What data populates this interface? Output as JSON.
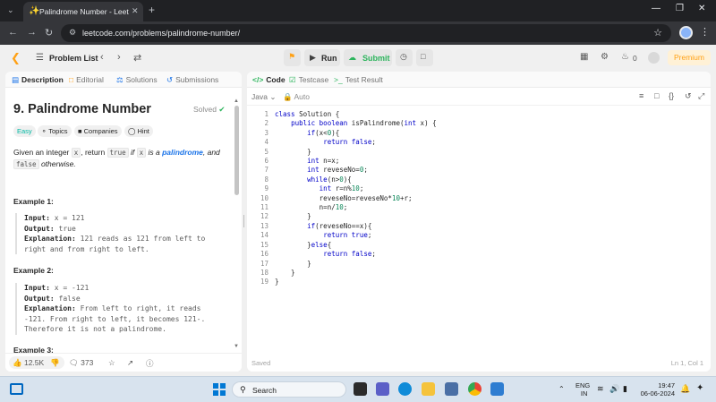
{
  "browser": {
    "tab_title": "Palindrome Number - LeetCode",
    "url": "leetcode.com/problems/palindrome-number/"
  },
  "navbar": {
    "problem_list": "Problem List",
    "run": "Run",
    "submit": "Submit",
    "streak_count": "0",
    "premium": "Premium"
  },
  "left_tabs": [
    "Description",
    "Editorial",
    "Solutions",
    "Submissions"
  ],
  "problem": {
    "title": "9. Palindrome Number",
    "status": "Solved",
    "tags": [
      "Easy",
      "Topics",
      "Companies",
      "Hint"
    ],
    "desc": {
      "p1": "Given an integer ",
      "x": "x",
      "p2": ", return ",
      "true": "true",
      "p3": " if ",
      "p4": " is a ",
      "palindrome": "palindrome",
      "p5": ", and",
      "false": "false",
      "p6": " otherwise."
    },
    "examples": [
      {
        "title": "Example 1:",
        "input_label": "Input:",
        "input": "x = 121",
        "output_label": "Output:",
        "output": "true",
        "explanation_label": "Explanation:",
        "explanation_1": "121 reads as 121 from left to",
        "explanation_2": "right and from right to left.",
        "explanation_3": ""
      },
      {
        "title": "Example 2:",
        "input_label": "Input:",
        "input": "x = -121",
        "output_label": "Output:",
        "output": "false",
        "explanation_label": "Explanation:",
        "explanation_1": "From left to right, it reads",
        "explanation_2": "-121. From right to left, it becomes 121-.",
        "explanation_3": "Therefore it is not a palindrome."
      }
    ],
    "example3_title": "Example 3:"
  },
  "left_footer": {
    "likes": "12.5K",
    "comments": "373"
  },
  "editor": {
    "tabs": [
      "Code",
      "Testcase",
      "Test Result"
    ],
    "language": "Java",
    "auto": "Auto",
    "code_lines": [
      "class Solution {",
      "    public boolean isPalindrome(int x) {",
      "        if(x<0){",
      "            return false;",
      "        }",
      "        int n=x;",
      "        int reveseNo=0;",
      "        while(n>0){",
      "           int r=n%10;",
      "           reveseNo=reveseNo*10+r;",
      "           n=n/10;",
      "        }",
      "        if(reveseNo==x){",
      "            return true;",
      "        }else{",
      "            return false;",
      "        }",
      "    }",
      "}"
    ],
    "status": "Saved",
    "cursor": "Ln 1, Col 1"
  },
  "taskbar": {
    "search": "Search",
    "lang_1": "ENG",
    "lang_2": "IN",
    "time": "19:47",
    "date": "06-06-2024"
  }
}
